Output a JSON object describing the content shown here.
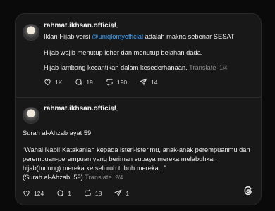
{
  "posts": [
    {
      "username": "rahmat.ikhsan.official",
      "time": "6d",
      "line1_pre": "Iklan Hijab versi ",
      "mention": "@uniqlomyofficial",
      "line1_post": " adalah makna sebenar SESAT",
      "line2": "Hijab wajib menutup leher dan menutup belahan dada.",
      "line3": "Hijab lambang kecantikan dalam kesederhanaan.",
      "translate": "Translate",
      "page": "1/4",
      "likes": "1K",
      "replies": "19",
      "reposts": "190",
      "shares": "14"
    },
    {
      "username": "rahmat.ikhsan.official",
      "time": "6d",
      "line1": "Surah al-Ahzab ayat 59",
      "line2": "“Wahai Nabi! Katakanlah kepada isteri-isterimu, anak-anak perempuanmu dan",
      "line3": "perempuan-perempuan yang beriman supaya mereka melabuhkan",
      "line4": "hijab(tudung) mereka ke seluruh tubuh mereka...”",
      "line5": "(Surah al-Ahzab: 59)",
      "translate": "Translate",
      "page": "2/4",
      "likes": "124",
      "replies": "1",
      "reposts": "18",
      "shares": "1"
    }
  ],
  "icons": {
    "like": "heart-icon",
    "reply": "comment-icon",
    "repost": "repost-icon",
    "share": "send-icon",
    "brand": "threads-logo-icon"
  },
  "colors": {
    "mention": "#3d9ff5",
    "card_bg": "#181818",
    "page_bg": "#0a0a0a"
  }
}
